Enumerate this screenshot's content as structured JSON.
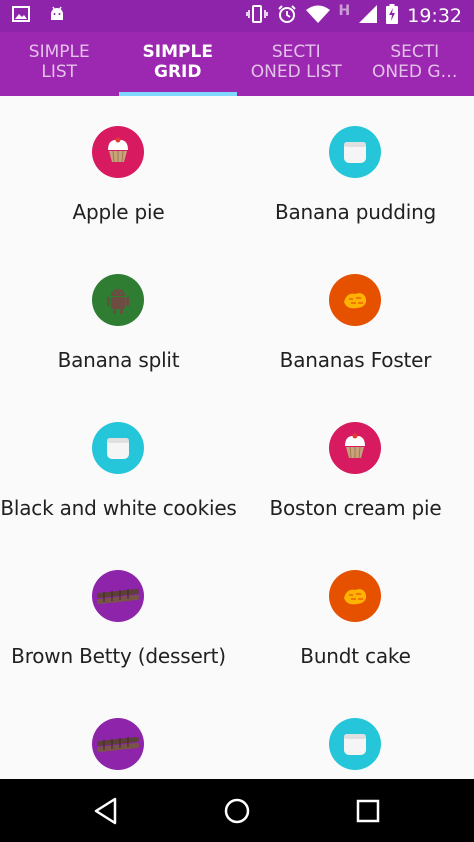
{
  "status_bar": {
    "time": "19:32",
    "network_letter": "H",
    "icons": [
      "image-icon",
      "android-icon",
      "vibrate-icon",
      "alarm-icon",
      "wifi-icon",
      "signal-icon",
      "battery-charging-icon"
    ]
  },
  "tabs": [
    {
      "label": "SIMPLE\nLIST",
      "active": false
    },
    {
      "label": "SIMPLE\nGRID",
      "active": true
    },
    {
      "label": "SECTI\nONED LIST",
      "active": false
    },
    {
      "label": "SECTI\nONED G…",
      "active": false
    }
  ],
  "grid_items": [
    {
      "label": "Apple pie",
      "icon": "cupcake-icon",
      "color": "#d81b60"
    },
    {
      "label": "Banana pudding",
      "icon": "marshmallow-icon",
      "color": "#26c6da"
    },
    {
      "label": "Banana split",
      "icon": "android-icon",
      "color": "#2e7d32"
    },
    {
      "label": "Bananas Foster",
      "icon": "honeycomb-icon",
      "color": "#e65100"
    },
    {
      "label": "Black and white cookies",
      "icon": "marshmallow-icon",
      "color": "#26c6da"
    },
    {
      "label": "Boston cream pie",
      "icon": "cupcake-icon",
      "color": "#d81b60"
    },
    {
      "label": "Brown Betty (dessert)",
      "icon": "wafer-icon",
      "color": "#8e24aa"
    },
    {
      "label": "Bundt cake",
      "icon": "honeycomb-icon",
      "color": "#e65100"
    },
    {
      "label": "",
      "icon": "wafer-icon",
      "color": "#8e24aa"
    },
    {
      "label": "",
      "icon": "marshmallow-icon",
      "color": "#26c6da"
    }
  ],
  "colors": {
    "status_bar": "#8e24aa",
    "app_bar": "#9c27b0",
    "tab_indicator": "#80d8ff"
  },
  "navigation": [
    "back-icon",
    "home-icon",
    "recents-icon"
  ]
}
